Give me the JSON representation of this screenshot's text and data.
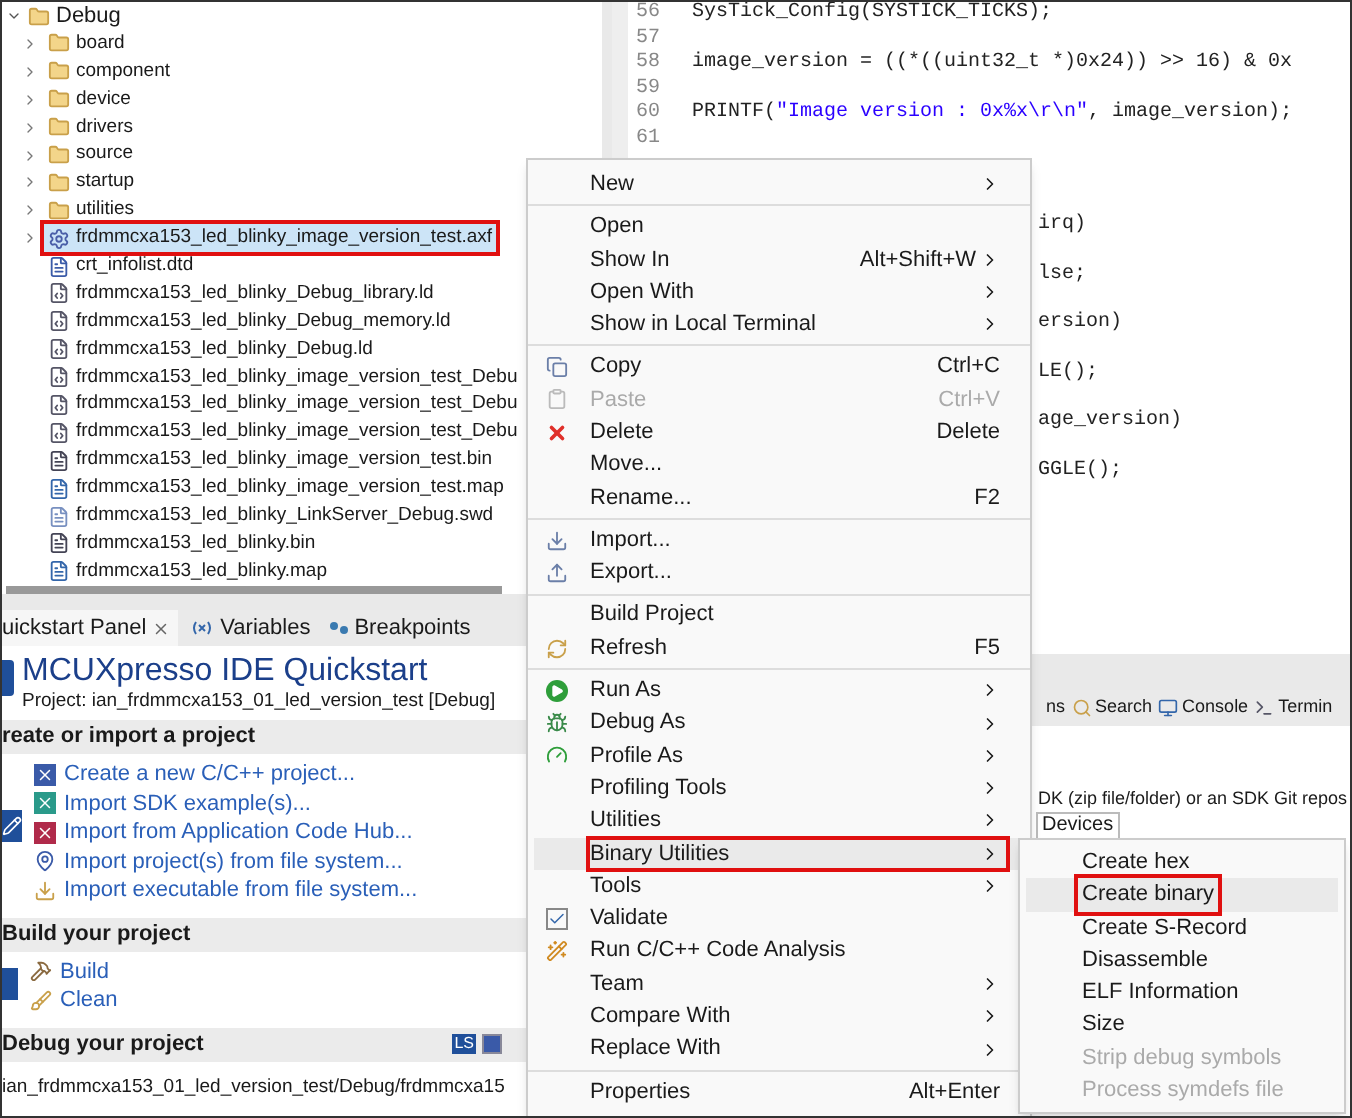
{
  "project_tree": {
    "root": {
      "label": "Debug",
      "expanded": true
    },
    "items": [
      {
        "label": "board",
        "kind": "folder",
        "expanded": false,
        "selected": false
      },
      {
        "label": "component",
        "kind": "folder",
        "expanded": false,
        "selected": false
      },
      {
        "label": "device",
        "kind": "folder",
        "expanded": false,
        "selected": false
      },
      {
        "label": "drivers",
        "kind": "folder",
        "expanded": false,
        "selected": false
      },
      {
        "label": "source",
        "kind": "folder",
        "expanded": false,
        "selected": false
      },
      {
        "label": "startup",
        "kind": "folder",
        "expanded": false,
        "selected": false
      },
      {
        "label": "utilities",
        "kind": "folder",
        "expanded": false,
        "selected": false
      },
      {
        "label": "frdmmcxa153_led_blinky_image_version_test.axf",
        "kind": "executable",
        "expanded": false,
        "selected": true
      },
      {
        "label": "crt_infolist.dtd",
        "kind": "dtd",
        "selected": false
      },
      {
        "label": "frdmmcxa153_led_blinky_Debug_library.ld",
        "kind": "linker",
        "selected": false
      },
      {
        "label": "frdmmcxa153_led_blinky_Debug_memory.ld",
        "kind": "linker",
        "selected": false
      },
      {
        "label": "frdmmcxa153_led_blinky_Debug.ld",
        "kind": "linker",
        "selected": false
      },
      {
        "label": "frdmmcxa153_led_blinky_image_version_test_Debu",
        "kind": "linker",
        "selected": false
      },
      {
        "label": "frdmmcxa153_led_blinky_image_version_test_Debu",
        "kind": "linker",
        "selected": false
      },
      {
        "label": "frdmmcxa153_led_blinky_image_version_test_Debu",
        "kind": "linker",
        "selected": false
      },
      {
        "label": "frdmmcxa153_led_blinky_image_version_test.bin",
        "kind": "binary",
        "selected": false
      },
      {
        "label": "frdmmcxa153_led_blinky_image_version_test.map",
        "kind": "map",
        "selected": false
      },
      {
        "label": "frdmmcxa153_led_blinky_LinkServer_Debug.swd",
        "kind": "document",
        "selected": false
      },
      {
        "label": "frdmmcxa153_led_blinky.bin",
        "kind": "binary",
        "selected": false
      },
      {
        "label": "frdmmcxa153_led_blinky.map",
        "kind": "map",
        "selected": false
      }
    ]
  },
  "editor": {
    "lines": [
      {
        "number": "56",
        "parts": [
          {
            "kind": "code",
            "text": "SysTick_Config(SYSTICK_TICKS);"
          }
        ]
      },
      {
        "number": "57"
      },
      {
        "number": "58",
        "parts": [
          {
            "kind": "code",
            "text": "image_version = ((*((uint32_t *)0x24)) >> 16) & 0x"
          }
        ]
      },
      {
        "number": "59"
      },
      {
        "number": "60",
        "parts": [
          {
            "kind": "code",
            "text": "PRINTF("
          },
          {
            "kind": "string",
            "text": "\"Image version : 0x%x\\r\\n\""
          },
          {
            "kind": "code",
            "text": ", image_version);"
          }
        ]
      },
      {
        "number": "61"
      }
    ],
    "fragments": [
      "irq)",
      "lse;",
      "ersion)",
      "LE();",
      "age_version)",
      "GGLE();"
    ]
  },
  "quickstart": {
    "tabs": [
      {
        "label": "uickstart Panel",
        "kind": "quickstart",
        "selected": true,
        "closable": true
      },
      {
        "label": "Variables",
        "kind": "variables",
        "selected": false,
        "closable": false
      },
      {
        "label": "Breakpoints",
        "kind": "breakpoints",
        "selected": false,
        "closable": false
      }
    ],
    "title": "MCUXpresso IDE Quickstart",
    "project": "Project: ian_frdmmcxa153_01_led_version_test [Debug]",
    "sections": [
      {
        "title": "reate or import a project",
        "kind": "import",
        "items": [
          {
            "label": "Create a new C/C++ project...",
            "kind": "create"
          },
          {
            "label": "Import SDK example(s)...",
            "kind": "sdk-example"
          },
          {
            "label": "Import from Application Code Hub...",
            "kind": "code-hub"
          },
          {
            "label": "Import project(s) from file system...",
            "kind": "import-project"
          },
          {
            "label": "Import executable from file system...",
            "kind": "import-executable"
          }
        ]
      },
      {
        "title": "Build your project",
        "kind": "build",
        "items": [
          {
            "label": "Build",
            "kind": "build"
          },
          {
            "label": "Clean",
            "kind": "clean"
          }
        ]
      },
      {
        "title": "Debug your project",
        "kind": "debug"
      }
    ],
    "debug_toolbar": [
      {
        "label": "LS",
        "kind": "linkserver"
      },
      {
        "kind": "probe"
      }
    ],
    "path": "ian_frdmmcxa153_01_led_version_test/Debug/frdmmcxa15"
  },
  "console_area": {
    "tabs": [
      {
        "label": "ns",
        "kind": "partial"
      },
      {
        "label": "Search",
        "kind": "search"
      },
      {
        "label": "Console",
        "kind": "console"
      },
      {
        "label": "Termin",
        "kind": "terminal"
      }
    ],
    "hint": "DK (zip file/folder) or an SDK Git repos",
    "devices_tab": "Devices"
  },
  "context_menu": {
    "groups": [
      [
        {
          "label": "New",
          "kind": "plain",
          "submenu": true,
          "disabled": false,
          "selected": false
        }
      ],
      [
        {
          "label": "Open",
          "kind": "plain",
          "submenu": false,
          "disabled": false,
          "selected": false
        },
        {
          "label": "Show In",
          "shortcut": "Alt+Shift+W",
          "kind": "plain",
          "submenu": true,
          "disabled": false,
          "selected": false
        },
        {
          "label": "Open With",
          "kind": "plain",
          "submenu": true,
          "disabled": false,
          "selected": false
        },
        {
          "label": "Show in Local Terminal",
          "kind": "plain",
          "submenu": true,
          "disabled": false,
          "selected": false
        }
      ],
      [
        {
          "label": "Copy",
          "shortcut": "Ctrl+C",
          "kind": "copy",
          "submenu": false,
          "disabled": false,
          "selected": false
        },
        {
          "label": "Paste",
          "shortcut": "Ctrl+V",
          "kind": "paste",
          "submenu": false,
          "disabled": true,
          "selected": false
        },
        {
          "label": "Delete",
          "shortcut": "Delete",
          "kind": "delete",
          "submenu": false,
          "disabled": false,
          "selected": false
        },
        {
          "label": "Move...",
          "kind": "plain",
          "submenu": false,
          "disabled": false,
          "selected": false
        },
        {
          "label": "Rename...",
          "shortcut": "F2",
          "kind": "plain",
          "submenu": false,
          "disabled": false,
          "selected": false
        }
      ],
      [
        {
          "label": "Import...",
          "kind": "import",
          "submenu": false,
          "disabled": false,
          "selected": false
        },
        {
          "label": "Export...",
          "kind": "export",
          "submenu": false,
          "disabled": false,
          "selected": false
        }
      ],
      [
        {
          "label": "Build Project",
          "kind": "plain",
          "submenu": false,
          "disabled": false,
          "selected": false
        },
        {
          "label": "Refresh",
          "shortcut": "F5",
          "kind": "refresh",
          "submenu": false,
          "disabled": false,
          "selected": false
        }
      ],
      [
        {
          "label": "Run As",
          "kind": "run",
          "submenu": true,
          "disabled": false,
          "selected": false
        },
        {
          "label": "Debug As",
          "kind": "debug",
          "submenu": true,
          "disabled": false,
          "selected": false
        },
        {
          "label": "Profile As",
          "kind": "profile",
          "submenu": true,
          "disabled": false,
          "selected": false
        },
        {
          "label": "Profiling Tools",
          "kind": "plain",
          "submenu": true,
          "disabled": false,
          "selected": false
        },
        {
          "label": "Utilities",
          "kind": "plain",
          "submenu": true,
          "disabled": false,
          "selected": false
        },
        {
          "label": "Binary Utilities",
          "kind": "plain",
          "submenu": true,
          "disabled": false,
          "selected": true
        },
        {
          "label": "Tools",
          "kind": "plain",
          "submenu": true,
          "disabled": false,
          "selected": false
        },
        {
          "label": "Validate",
          "kind": "validate",
          "submenu": false,
          "disabled": false,
          "selected": false
        },
        {
          "label": "Run C/C++ Code Analysis",
          "kind": "analysis",
          "submenu": false,
          "disabled": false,
          "selected": false
        },
        {
          "label": "Team",
          "kind": "plain",
          "submenu": true,
          "disabled": false,
          "selected": false
        },
        {
          "label": "Compare With",
          "kind": "plain",
          "submenu": true,
          "disabled": false,
          "selected": false
        },
        {
          "label": "Replace With",
          "kind": "plain",
          "submenu": true,
          "disabled": false,
          "selected": false
        }
      ],
      [
        {
          "label": "Properties",
          "shortcut": "Alt+Enter",
          "kind": "plain",
          "submenu": false,
          "disabled": false,
          "selected": false
        }
      ]
    ]
  },
  "submenu": {
    "items": [
      {
        "label": "Create hex",
        "disabled": false,
        "selected": false
      },
      {
        "label": "Create binary",
        "disabled": false,
        "selected": true
      },
      {
        "label": "Create S-Record",
        "disabled": false,
        "selected": false
      },
      {
        "label": "Disassemble",
        "disabled": false,
        "selected": false
      },
      {
        "label": "ELF Information",
        "disabled": false,
        "selected": false
      },
      {
        "label": "Size",
        "disabled": false,
        "selected": false
      },
      {
        "label": "Strip debug symbols",
        "disabled": true,
        "selected": false
      },
      {
        "label": "Process symdefs file",
        "disabled": true,
        "selected": false
      }
    ]
  }
}
